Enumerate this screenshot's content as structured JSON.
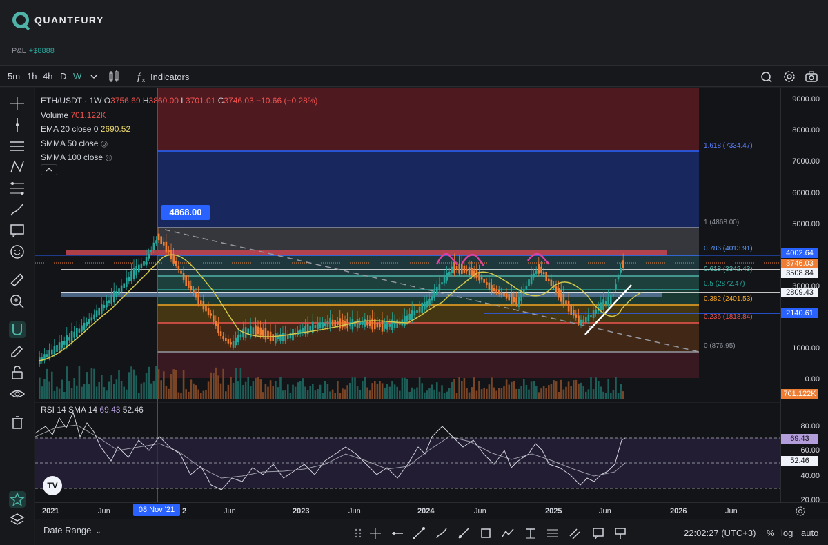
{
  "app": {
    "brand": "QUANTFURY"
  },
  "pnl": {
    "label": "P&L",
    "value": "+$8888"
  },
  "toolbar": {
    "timeframes": [
      "5m",
      "1h",
      "4h",
      "D",
      "W"
    ],
    "active_timeframe": "W",
    "indicators_label": "Indicators"
  },
  "legend": {
    "symbol": "ETH/USDT · 1W",
    "open_label": "O",
    "open": "3756.69",
    "high_label": "H",
    "high": "3860.00",
    "low_label": "L",
    "low": "3701.01",
    "close_label": "C",
    "close": "3746.03",
    "change": "−10.66 (−0.28%)",
    "volume_label": "Volume",
    "volume": "701.122K",
    "ema_label": "EMA 20 close 0",
    "ema": "2690.52",
    "smma50_label": "SMMA 50 close",
    "smma100_label": "SMMA 100 close"
  },
  "rsi_legend": {
    "label": "RSI 14 SMA 14",
    "rsi": "69.43",
    "sma": "52.46"
  },
  "price_axis": [
    "9000.00",
    "8000.00",
    "7000.00",
    "6000.00",
    "5000.00",
    "3000.00",
    "1000.00",
    "0.00",
    "80.00",
    "60.00",
    "40.00",
    "20.00"
  ],
  "price_tags": [
    {
      "value": "4002.64",
      "color": "#2962ff"
    },
    {
      "value": "3746.03",
      "color": "#ef7d33"
    },
    {
      "value": "3508.84",
      "color": "#f0f3fa"
    },
    {
      "value": "2809.43",
      "color": "#f0f3fa"
    },
    {
      "value": "2140.61",
      "color": "#2962ff"
    },
    {
      "value": "701.122K",
      "color": "#ef7d33"
    },
    {
      "value": "69.43",
      "color": "#b39ddb"
    },
    {
      "value": "52.46",
      "color": "#f0f3fa"
    }
  ],
  "fib_levels": [
    {
      "label": "1.618 (7334.47)",
      "color": "#5b7fff"
    },
    {
      "label": "1 (4868.00)",
      "color": "#8d9099"
    },
    {
      "label": "0.786 (4013.91)",
      "color": "#5b9cff"
    },
    {
      "label": "0.618 (3342.43)",
      "color": "#4fb3a8"
    },
    {
      "label": "0.5 (2872.47)",
      "color": "#26a69a"
    },
    {
      "label": "0.382 (2401.53)",
      "color": "#f5a623"
    },
    {
      "label": "0.236 (1818.84)",
      "color": "#ef5350"
    },
    {
      "label": "0 (876.95)",
      "color": "#8d9099"
    }
  ],
  "peak_flag": "4868.00",
  "date_flag": "08 Nov '21",
  "time_axis": [
    "2021",
    "Jun",
    "2",
    "Jun",
    "2023",
    "Jun",
    "2024",
    "Jun",
    "2025",
    "Jun",
    "2026",
    "Jun"
  ],
  "bottom": {
    "date_range": "Date Range",
    "clock": "22:02:27 (UTC+3)",
    "percent": "%",
    "log": "log",
    "auto": "auto"
  }
}
